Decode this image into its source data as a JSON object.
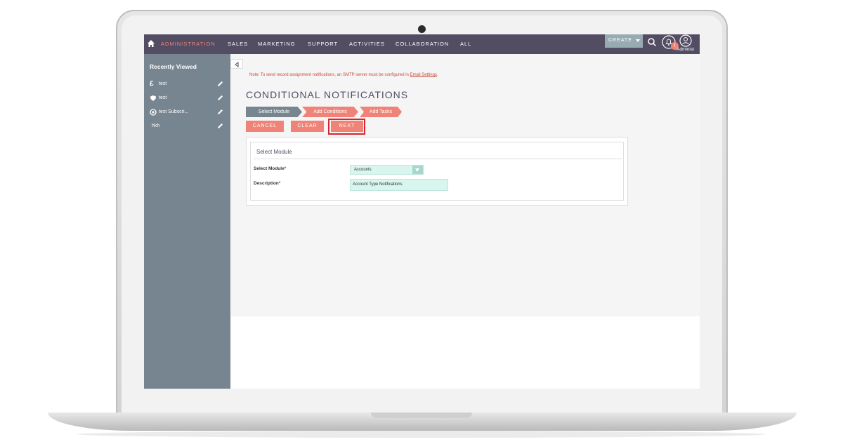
{
  "nav": {
    "items": [
      {
        "label": "ADMINISTRATION",
        "active": true
      },
      {
        "label": "SALES"
      },
      {
        "label": "MARKETING"
      },
      {
        "label": "SUPPORT"
      },
      {
        "label": "ACTIVITIES"
      },
      {
        "label": "COLLABORATION"
      },
      {
        "label": "ALL"
      }
    ],
    "create_label": "CREATE",
    "notification_count": "1",
    "user_label": "Administ"
  },
  "sidebar": {
    "title": "Recently Viewed",
    "items": [
      {
        "label": "test",
        "icon": "pound-icon"
      },
      {
        "label": "test",
        "icon": "shield-icon"
      },
      {
        "label": "test Subscri...",
        "icon": "target-icon"
      },
      {
        "label": "hkh",
        "icon": ""
      }
    ]
  },
  "main": {
    "note_text": "Note: To send record assignment notifications, an SMTP server must be configured in ",
    "note_link": "Email Settings",
    "note_end": ".",
    "title": "CONDITIONAL NOTIFICATIONS",
    "steps": [
      "Select Module",
      "Add Conditions",
      "Add Tasks"
    ],
    "buttons": {
      "cancel": "CANCEL",
      "clear": "CLEAR",
      "next": "NEXT"
    },
    "panel": {
      "title": "Select Module",
      "module_label": "Select Module",
      "module_value": "Accounts",
      "description_label": "Description",
      "description_value": "Account Type Notifications"
    }
  },
  "colors": {
    "nav_bg": "#534d64",
    "accent": "#f08377",
    "sidebar_bg": "#778591",
    "highlight": "#d9232d",
    "field_bg": "#d8f5ee"
  }
}
